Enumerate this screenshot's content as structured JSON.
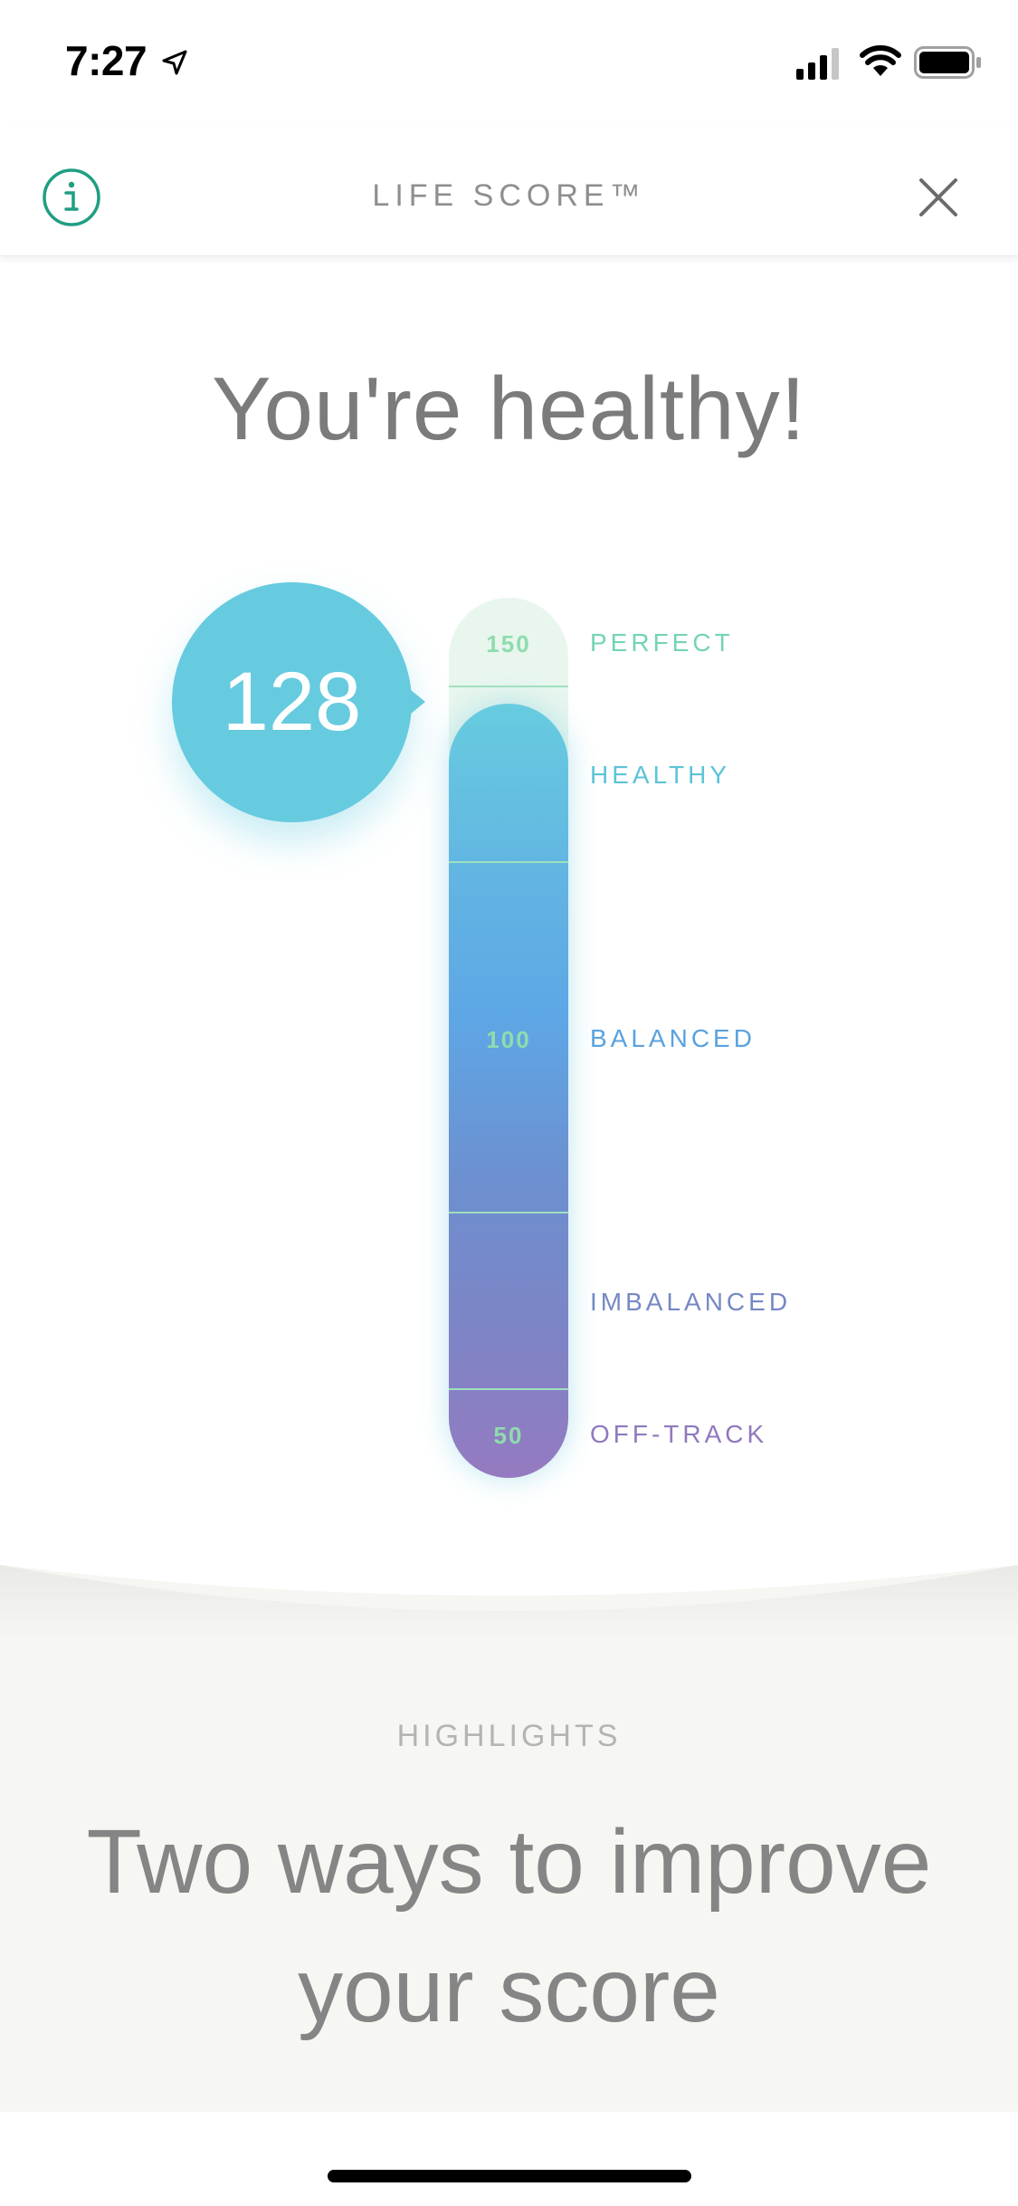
{
  "status_bar": {
    "time": "7:27",
    "icons": [
      "location-arrow-icon",
      "cellular-signal-icon",
      "wifi-icon",
      "battery-icon"
    ]
  },
  "header": {
    "title": "LIFE SCORE™",
    "left_icon": "info-icon",
    "right_icon": "close-icon"
  },
  "hero": {
    "title": "You're healthy!"
  },
  "score": {
    "value": "128",
    "level": 128
  },
  "gauge": {
    "ticks": [
      "150",
      "100",
      "50"
    ],
    "levels": [
      {
        "label": "PERFECT",
        "color": "#74d4b4"
      },
      {
        "label": "HEALTHY",
        "color": "#5bc4d8"
      },
      {
        "label": "BALANCED",
        "color": "#5aa2de"
      },
      {
        "label": "IMBALANCED",
        "color": "#7688c5"
      },
      {
        "label": "OFF-TRACK",
        "color": "#9079bd"
      }
    ]
  },
  "highlights": {
    "label": "HIGHLIGHTS",
    "heading": "Two ways to improve your score"
  },
  "colors": {
    "accent_green": "#1f9e82",
    "bubble": "#66cbdf",
    "gauge_track": "#e8f6ee",
    "panel_bg": "#f6f6f2"
  }
}
